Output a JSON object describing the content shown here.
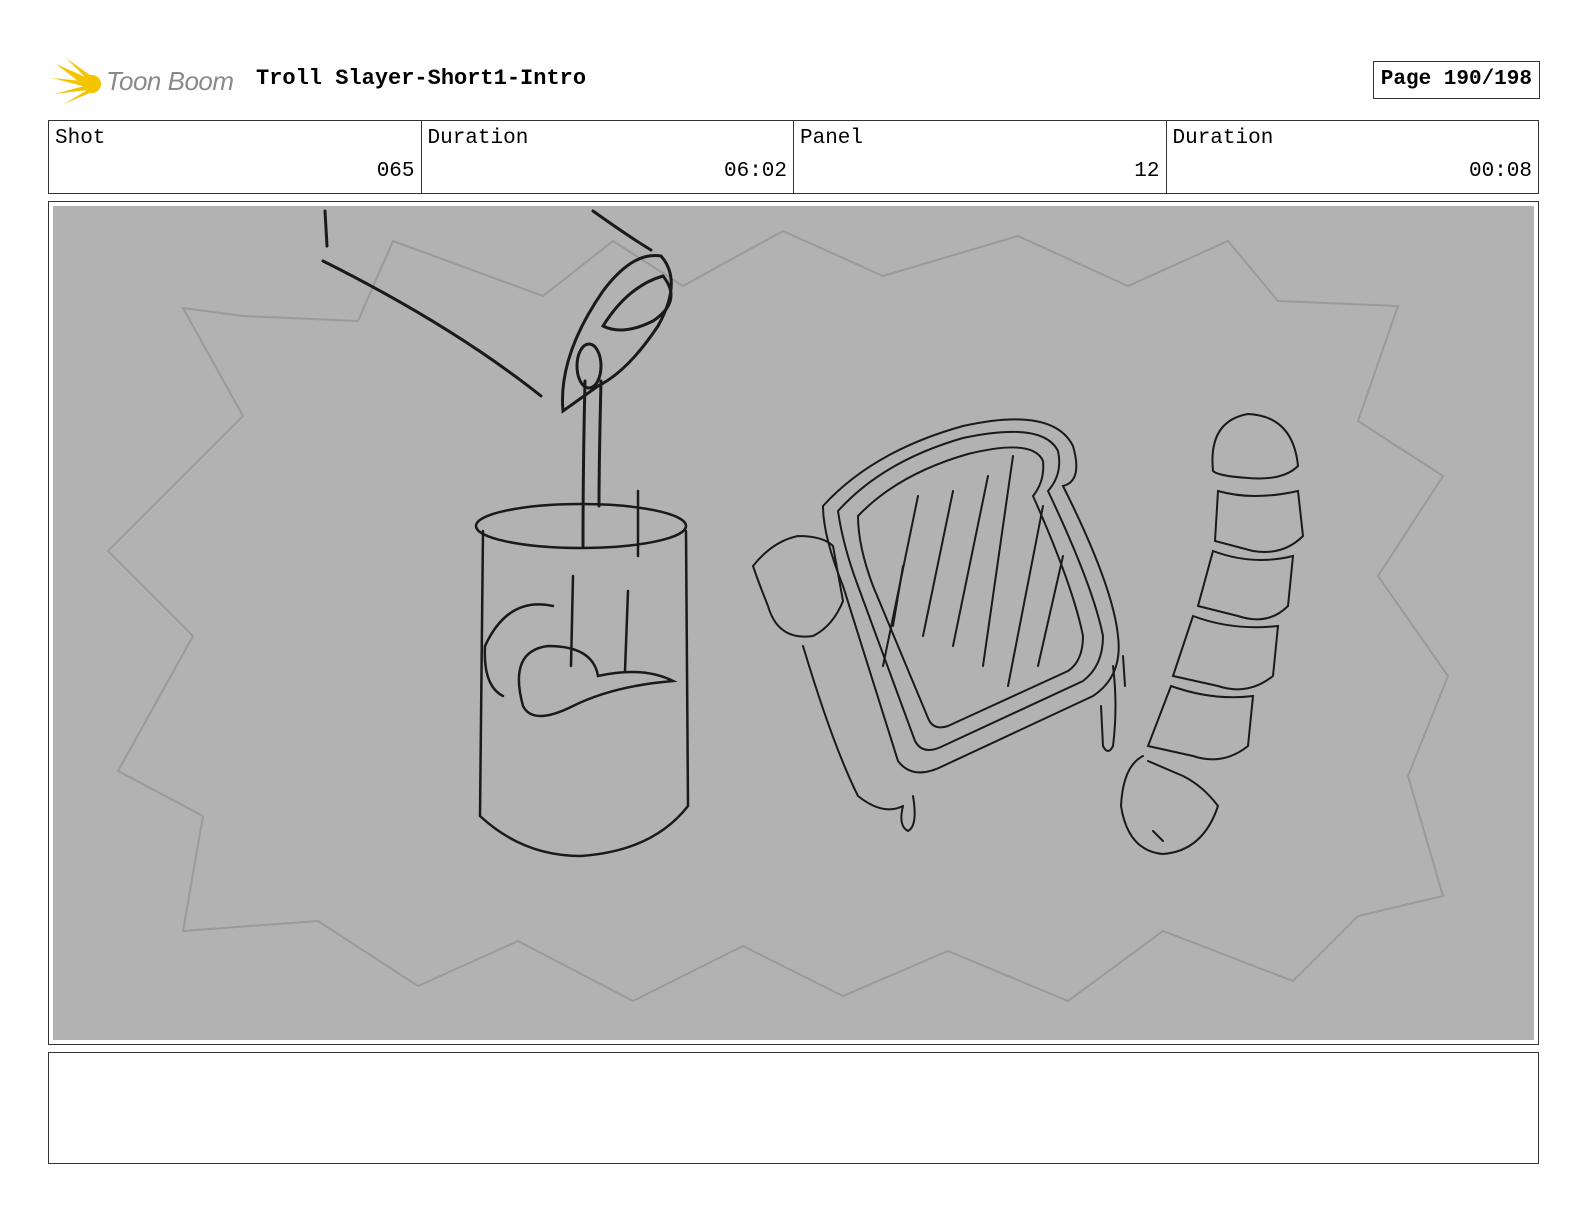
{
  "header": {
    "logo_text": "Toon Boom",
    "title": "Troll Slayer-Short1-Intro",
    "page": "Page 190/198"
  },
  "info": {
    "shot_label": "Shot",
    "shot_value": "065",
    "duration_label": "Duration",
    "duration_value": "06:02",
    "panel_label": "Panel",
    "panel_value": "12",
    "panel_duration_label": "Duration",
    "panel_duration_value": "00:08"
  },
  "colors": {
    "logo_accent": "#f5c400",
    "panel_background": "#b2b2b2",
    "sketch_line": "#1a1a1a",
    "burst_line": "#9a9a9a"
  },
  "notes": {
    "text": ""
  }
}
